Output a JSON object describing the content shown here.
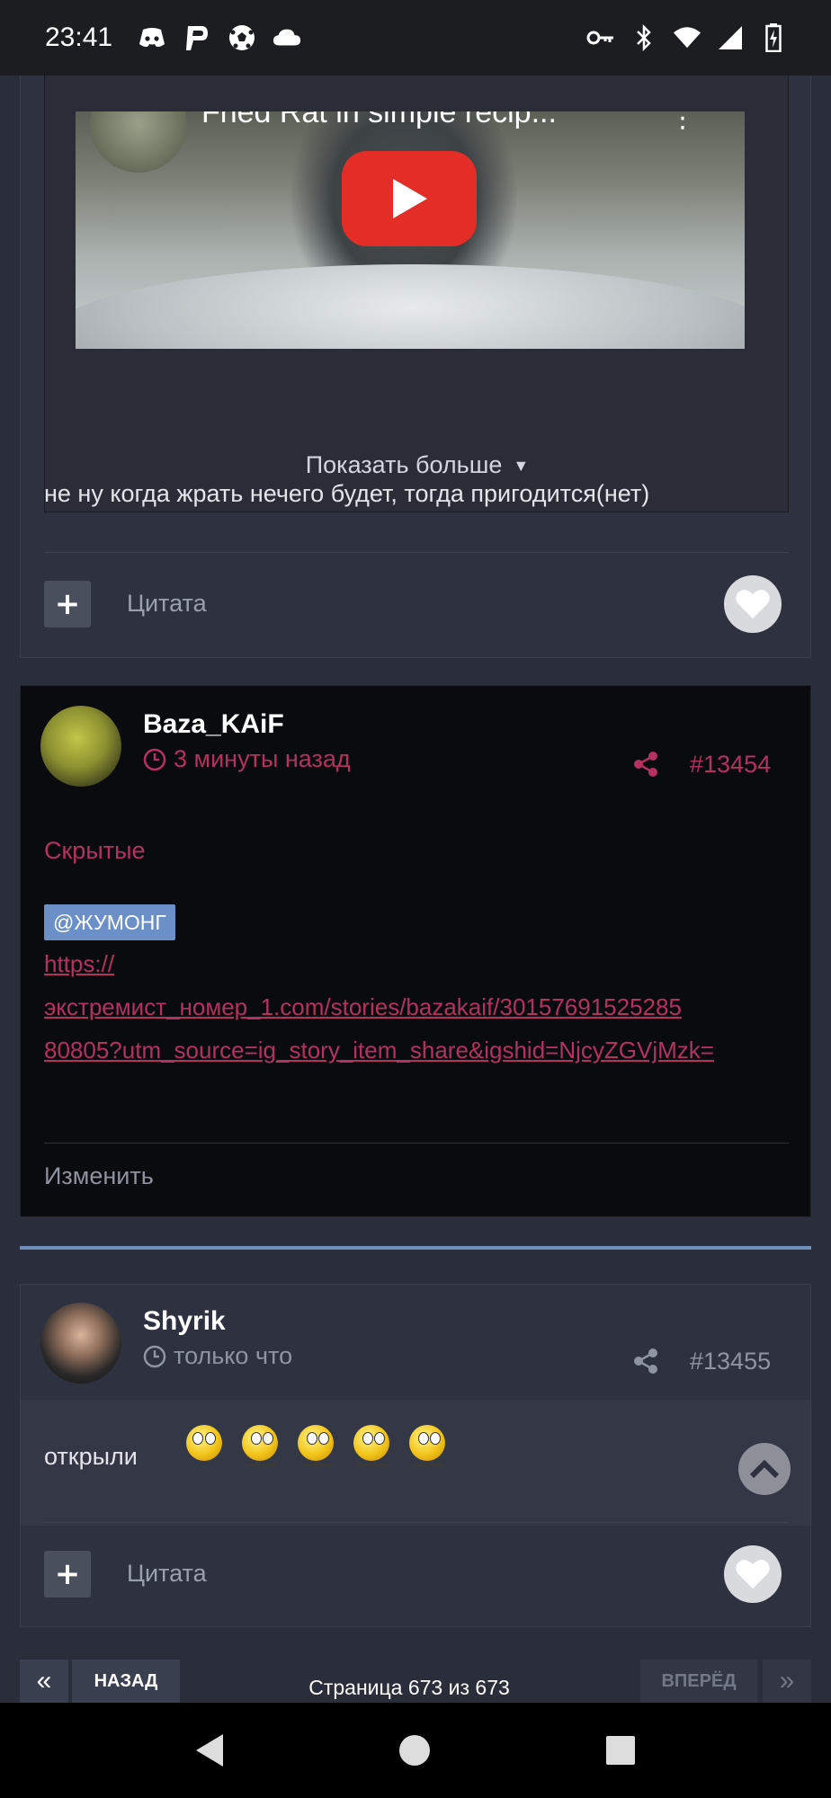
{
  "status_bar": {
    "time": "23:41",
    "left_icons": [
      "discord-icon",
      "pocket-p-icon",
      "soccer-ball-icon",
      "cloud-icon"
    ],
    "right_icons": [
      "key-icon",
      "bluetooth-icon",
      "wifi-icon",
      "signal-icon",
      "battery-icon"
    ]
  },
  "post_1": {
    "video_title": "Fried Rat in simple recip...",
    "show_more": "Показать больше",
    "text": "не ну когда жрать нечего будет, тогда пригодится(нет)",
    "quote_label": "Цитата"
  },
  "post_2": {
    "username": "Baza_KAiF",
    "time": "3 минуты назад",
    "post_number": "#13454",
    "hidden_label": "Скрытые",
    "mention": "@ЖУМОНГ",
    "link_lines": [
      "https://",
      "экстремист_номер_1.com/stories/bazakaif/30157691525285",
      "80805?utm_source=ig_story_item_share&igshid=NjcyZGVjMzk="
    ],
    "edit_label": "Изменить",
    "accent_color": "#b5315f"
  },
  "post_3": {
    "username": "Shyrik",
    "time": "только что",
    "post_number": "#13455",
    "text": "открыли",
    "quote_label": "Цитата"
  },
  "pagination": {
    "first": "«",
    "prev": "НАЗАД",
    "info": "Страница 673 из 673",
    "next": "ВПЕРЁД",
    "last": "»"
  }
}
